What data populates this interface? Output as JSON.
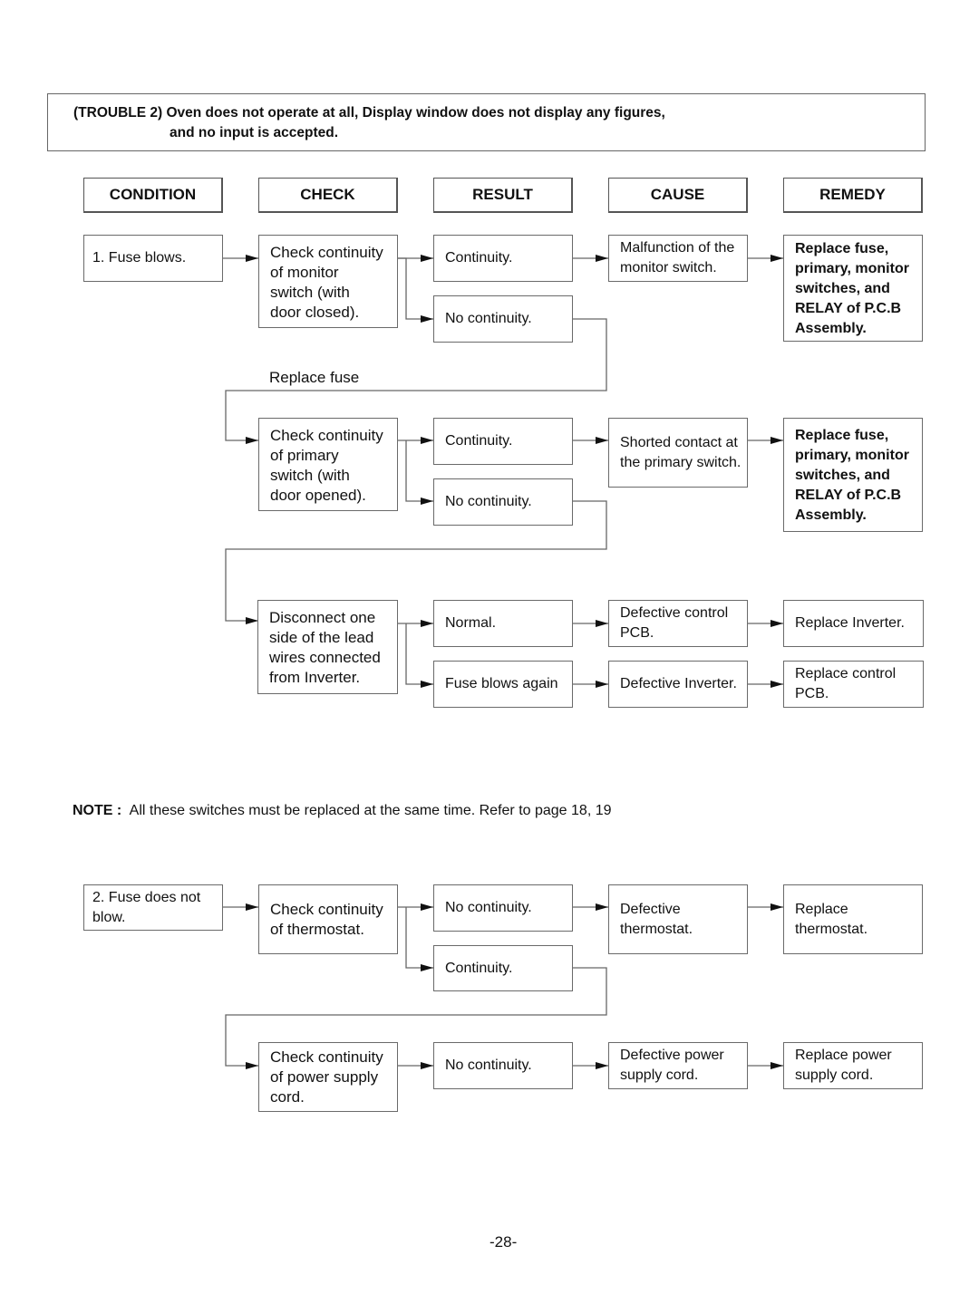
{
  "title": {
    "line1": "(TROUBLE 2) Oven does not operate at all, Display window does not display any figures,",
    "line2": "and no input is accepted."
  },
  "headers": [
    "CONDITION",
    "CHECK",
    "RESULT",
    "CAUSE",
    "REMEDY"
  ],
  "section1": {
    "condition": "1. Fuse blows.",
    "step1": {
      "check": "Check continuity\nof monitor\nswitch (with\ndoor closed).",
      "result_yes": "Continuity.",
      "result_no": "No continuity.",
      "cause": "Malfunction of the\nmonitor switch.",
      "remedy": "Replace fuse,\nprimary, monitor\nswitches, and\nRELAY of P.C.B\nAssembly."
    },
    "connector_label": "Replace fuse",
    "step2": {
      "check": "Check continuity\nof primary\nswitch (with\ndoor opened).",
      "result_yes": "Continuity.",
      "result_no": "No continuity.",
      "cause": "Shorted contact at\nthe primary switch.",
      "remedy": "Replace fuse,\nprimary, monitor\nswitches, and\nRELAY of P.C.B\nAssembly."
    },
    "step3": {
      "check": "Disconnect one\nside of the lead\nwires  connected\nfrom Inverter.",
      "result_a": "Normal.",
      "result_b": "Fuse blows again",
      "cause_a": "Defective control\nPCB.",
      "cause_b": "Defective Inverter.",
      "remedy_a": "Replace Inverter.",
      "remedy_b": "Replace control\nPCB."
    }
  },
  "note": {
    "label": "NOTE :",
    "text": "All these switches must be replaced at the same time. Refer to page 18, 19"
  },
  "section2": {
    "condition": "2. Fuse does not\n    blow.",
    "step1": {
      "check": "Check continuity\nof thermostat.",
      "result_no": "No continuity.",
      "result_yes": "Continuity.",
      "cause": "Defective\nthermostat.",
      "remedy": "Replace\nthermostat."
    },
    "step2": {
      "check": "Check continuity\nof power  supply\ncord.",
      "result": "No continuity.",
      "cause": "Defective power\nsupply cord.",
      "remedy": "Replace power\nsupply cord."
    }
  },
  "page_number": "-28-"
}
